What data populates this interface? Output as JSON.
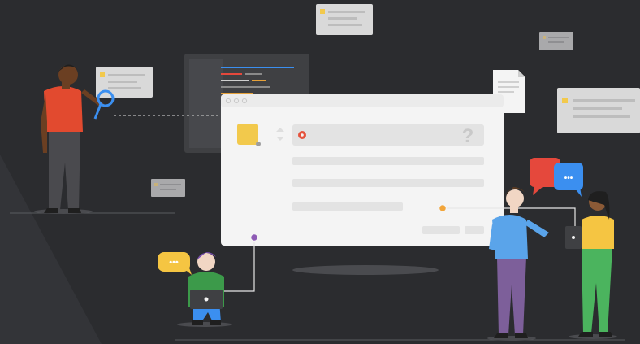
{
  "illustration": {
    "help_symbol": "?",
    "chat_dots": "•••",
    "colors": {
      "background": "#2b2c2f",
      "card": "#d9d9d9",
      "card_bar": "#bdbdbd",
      "card_accent": "#f2c94c",
      "dialog_bg": "#f4f4f4",
      "dialog_field": "#e3e3e3",
      "yellow_block": "#f2c94c",
      "red_dot": "#e5533d",
      "orange_dot": "#f2a53a",
      "purple_dot": "#8e5bb5",
      "bubble_red": "#e5483c",
      "bubble_blue": "#3b8ff0",
      "bubble_yellow": "#f5c542"
    },
    "icons": [
      "magnifier-icon",
      "document-icon",
      "chat-bubble-icon",
      "help-icon",
      "laptop-icon",
      "tablet-icon"
    ]
  }
}
